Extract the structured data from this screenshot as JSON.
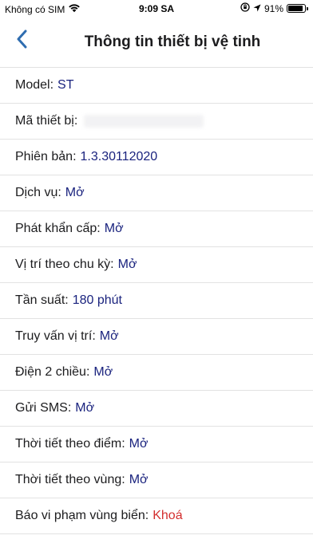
{
  "status_bar": {
    "carrier": "Không có SIM",
    "time": "9:09 SA",
    "battery_percent": "91%",
    "battery_level": 0.91,
    "icons": [
      "wifi-icon",
      "orientation-lock-icon",
      "location-arrow-icon",
      "battery-icon"
    ]
  },
  "nav": {
    "back_icon": "chevron-left-icon",
    "title": "Thông tin thiết bị vệ tinh",
    "accent_color": "#2f6db0"
  },
  "rows": [
    {
      "label": "Model:",
      "value": "ST",
      "value_color": "#1a237e"
    },
    {
      "label": "Mã thiết bị:",
      "value": "",
      "value_hidden": true
    },
    {
      "label": "Phiên bản:",
      "value": "1.3.30112020",
      "value_color": "#1a237e"
    },
    {
      "label": "Dịch vụ:",
      "value": "Mở",
      "value_color": "#1a237e"
    },
    {
      "label": "Phát khẩn cấp:",
      "value": "Mở",
      "value_color": "#1a237e"
    },
    {
      "label": "Vị trí theo chu kỳ:",
      "value": "Mở",
      "value_color": "#1a237e"
    },
    {
      "label": "Tần suất:",
      "value": "180 phút",
      "value_color": "#1a237e"
    },
    {
      "label": "Truy vấn vị trí:",
      "value": "Mở",
      "value_color": "#1a237e"
    },
    {
      "label": "Điện 2 chiều:",
      "value": "Mở",
      "value_color": "#1a237e"
    },
    {
      "label": "Gửi SMS:",
      "value": "Mở",
      "value_color": "#1a237e"
    },
    {
      "label": "Thời tiết theo điểm:",
      "value": "Mở",
      "value_color": "#1a237e"
    },
    {
      "label": "Thời tiết theo vùng:",
      "value": "Mở",
      "value_color": "#1a237e"
    },
    {
      "label": "Báo vi phạm vùng biển:",
      "value": "Khoá",
      "value_color": "#d32f2f"
    }
  ]
}
